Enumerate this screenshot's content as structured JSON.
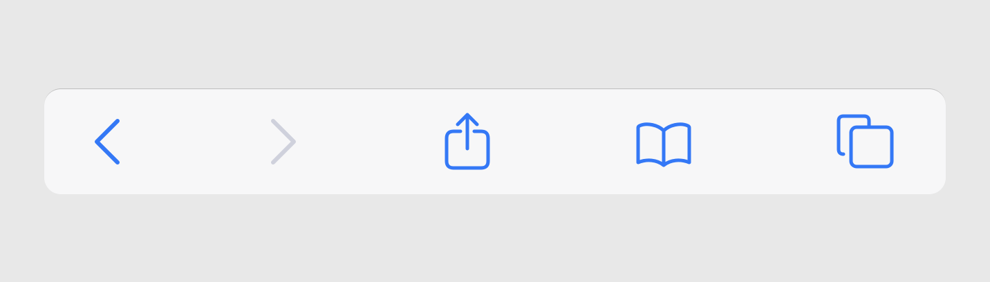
{
  "toolbar": {
    "accent_color": "#3478f6",
    "disabled_color": "#cfd1dc",
    "background_color": "#f7f7f8",
    "buttons": [
      {
        "id": "back",
        "icon": "chevron-left-icon",
        "enabled": true
      },
      {
        "id": "forward",
        "icon": "chevron-right-icon",
        "enabled": false
      },
      {
        "id": "share",
        "icon": "share-icon",
        "enabled": true
      },
      {
        "id": "bookmarks",
        "icon": "book-icon",
        "enabled": true
      },
      {
        "id": "tabs",
        "icon": "tabs-icon",
        "enabled": true
      }
    ]
  }
}
